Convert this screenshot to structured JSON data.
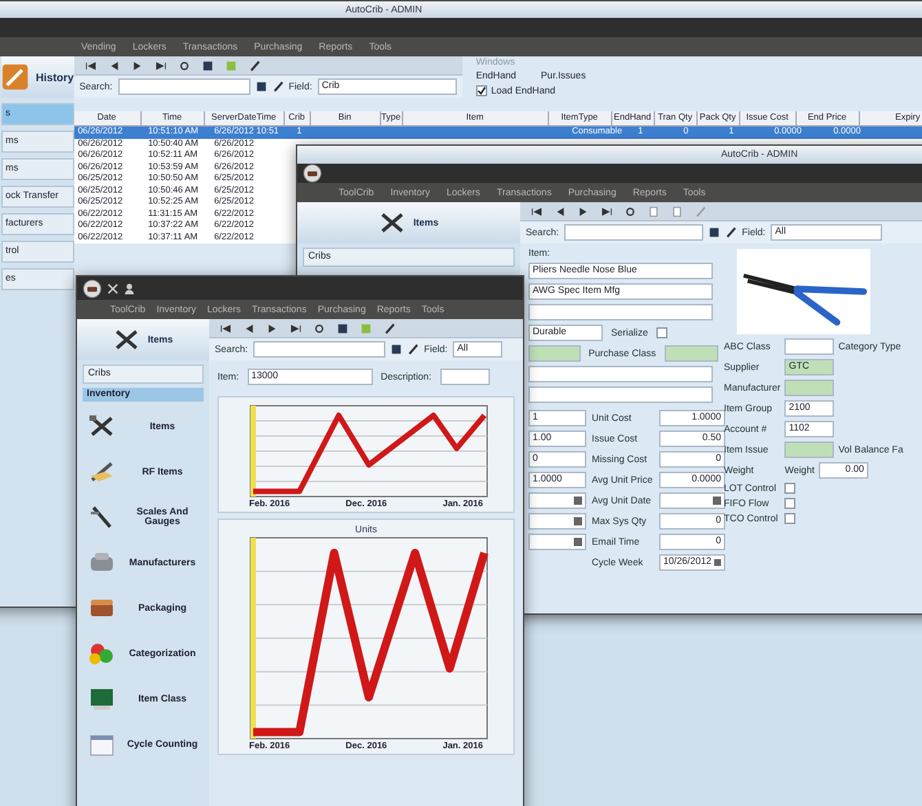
{
  "back_window": {
    "title": "AutoCrib - ADMIN",
    "menu": [
      "Vending",
      "Lockers",
      "Transactions",
      "Purchasing",
      "Reports",
      "Tools"
    ],
    "module": "History",
    "sidebar_items": [
      {
        "label": "s",
        "selected": true
      },
      {
        "label": "ms",
        "selected": false
      },
      {
        "label": "ms",
        "selected": false
      },
      {
        "label": "ock Transfer",
        "selected": false
      },
      {
        "label": "facturers",
        "selected": false
      },
      {
        "label": "trol",
        "selected": false
      },
      {
        "label": "es",
        "selected": false
      }
    ],
    "search_label": "Search:",
    "field_label": "Field:",
    "field_value": "Crib",
    "windows_label": "Windows",
    "options": [
      "EndHand",
      "Pur.Issues"
    ],
    "load_option": {
      "label": "Load EndHand",
      "checked": true
    },
    "table": {
      "columns": [
        "Date",
        "Time",
        "ServerDateTime",
        "Crib",
        "Bin",
        "Type",
        "Item",
        "ItemType",
        "EndHand",
        "Tran Qty",
        "Pack Qty",
        "Issue Cost",
        "End Price",
        "Expiry"
      ],
      "rows": [
        {
          "selected": true,
          "cells": [
            "06/26/2012",
            "10:51:10 AM",
            "6/26/2012 10:51",
            "1",
            "",
            "",
            "",
            "Consumable",
            "1",
            "0",
            "1",
            "0.0000",
            "0.0000"
          ]
        },
        {
          "selected": false,
          "cells": [
            "06/26/2012",
            "10:50:40 AM",
            "6/26/2012"
          ]
        },
        {
          "selected": false,
          "cells": [
            "06/26/2012",
            "10:52:11 AM",
            "6/26/2012"
          ]
        },
        {
          "selected": false,
          "cells": [
            "06/26/2012",
            "10:53:59 AM",
            "6/26/2012"
          ]
        },
        {
          "selected": false,
          "cells": [
            "06/25/2012",
            "10:50:50 AM",
            "6/25/2012"
          ]
        },
        {
          "selected": false,
          "cells": [
            "06/25/2012",
            "10:50:46 AM",
            "6/25/2012"
          ]
        },
        {
          "selected": false,
          "cells": [
            "06/25/2012",
            "10:52:25 AM",
            "6/25/2012"
          ]
        },
        {
          "selected": false,
          "cells": [
            "06/22/2012",
            "11:31:15 AM",
            "6/22/2012"
          ]
        },
        {
          "selected": false,
          "cells": [
            "06/22/2012",
            "10:37:22 AM",
            "6/22/2012"
          ]
        },
        {
          "selected": false,
          "cells": [
            "06/22/2012",
            "10:37:11 AM",
            "6/22/2012"
          ]
        }
      ]
    }
  },
  "middle_window": {
    "title": "AutoCrib - ADMIN",
    "menu": [
      "ToolCrib",
      "Inventory",
      "Lockers",
      "Transactions",
      "Purchasing",
      "Reports",
      "Tools"
    ],
    "module": "Items",
    "sidebar_items": [
      "Cribs"
    ],
    "search_label": "Search:",
    "field_label": "Field:",
    "field_value": "All",
    "item_label": "Item:",
    "form_rows": [
      {
        "kind": "field",
        "value": "Pliers Needle Nose Blue"
      },
      {
        "kind": "field",
        "value": "AWG Spec Item Mfg"
      },
      {
        "kind": "field"
      },
      {
        "kind": "select",
        "value": "Durable",
        "check_label": "Serialize",
        "checked": false
      },
      {
        "kind": "pair",
        "label": "Purchase Class"
      },
      {
        "kind": "field"
      },
      {
        "kind": "field"
      }
    ],
    "numbers": [
      {
        "value": "1",
        "label": "Unit Cost",
        "value2": "1.0000",
        "date": false,
        "date2": false
      },
      {
        "value": "1.00",
        "label": "Issue Cost",
        "value2": "0.50",
        "date": false,
        "date2": false
      },
      {
        "value": "0",
        "label": "Missing Cost",
        "value2": "0",
        "date": false,
        "date2": false
      },
      {
        "value": "1.0000",
        "label": "Avg Unit Price",
        "value2": "0.0000",
        "date": false,
        "date2": false
      },
      {
        "label": "Avg Unit Date",
        "date": true,
        "date2": true
      },
      {
        "label": "Max Sys Qty",
        "value2": "0",
        "date": true,
        "date2": false
      },
      {
        "label": "Email Time",
        "value2": "0",
        "date": true,
        "date2": false
      },
      {
        "label": "Cycle Week",
        "value2": "10/26/2012",
        "date2": true
      }
    ],
    "right_rows": [
      {
        "kind": "field",
        "label": "ABC Class",
        "extra": "Category Type"
      },
      {
        "kind": "green",
        "label": "Supplier",
        "value": "GTC"
      },
      {
        "kind": "green",
        "label": "Manufacturer"
      },
      {
        "kind": "field",
        "label": "Item Group",
        "value": "2100"
      },
      {
        "kind": "field",
        "label": "Account #",
        "value": "1102"
      },
      {
        "kind": "green",
        "label": "Item Issue",
        "extra": "Vol Balance Fa"
      },
      {
        "kind": "weight",
        "label": "Weight",
        "extra": "Weight",
        "value": "0.00"
      },
      {
        "kind": "check",
        "label": "LOT Control",
        "checked": false
      },
      {
        "kind": "check",
        "label": "FIFO Flow",
        "checked": false
      },
      {
        "kind": "check",
        "label": "TCO Control",
        "checked": false
      }
    ]
  },
  "front_window": {
    "menu": [
      "ToolCrib",
      "Inventory",
      "Lockers",
      "Transactions",
      "Purchasing",
      "Reports",
      "Tools"
    ],
    "module": "Items",
    "search_label": "Search:",
    "field_label": "Field:",
    "field_value": "All",
    "cribs": "Cribs",
    "section": "Inventory",
    "sidebar_items": [
      "Items",
      "RF Items",
      "Scales And Gauges",
      "Manufacturers",
      "Packaging",
      "Categorization",
      "Item Class",
      "Cycle Counting"
    ],
    "item_label": "Item:",
    "item_value": "13000",
    "description_label": "Description:",
    "charts": [
      {
        "x_labels": [
          "Feb. 2016",
          "Dec. 2016",
          "Jan. 2016"
        ]
      },
      {
        "title": "Units",
        "x_labels": [
          "Feb. 2016",
          "Dec. 2016",
          "Jan. 2016"
        ]
      }
    ]
  }
}
